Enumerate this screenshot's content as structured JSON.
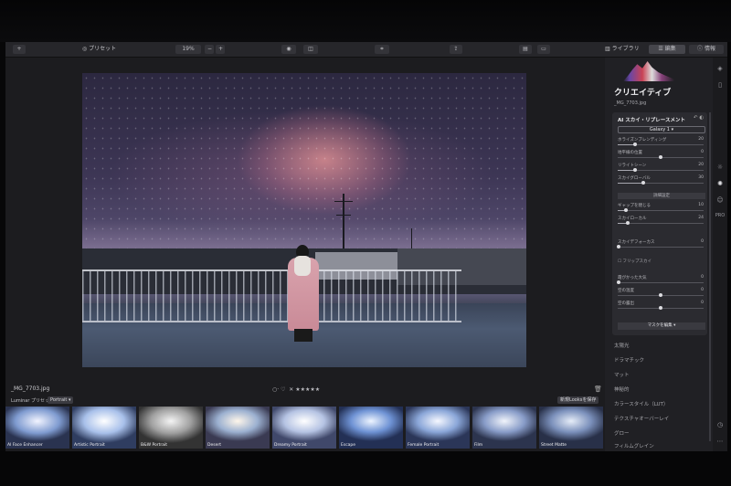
{
  "toolbar": {
    "add": "+",
    "presets": "プリセット",
    "zoom": "19%",
    "zoom_out": "−",
    "zoom_in": "+",
    "library": "ライブラリ",
    "edit": "編集",
    "info": "情報"
  },
  "image": {
    "filename": "_MG_7703.jpg"
  },
  "rating": {
    "flag_icon": "○",
    "heart": "♡",
    "reject": "✕",
    "stars": "★★★★★"
  },
  "presets_bar": {
    "label": "Luminar プリセット",
    "category": "Portrait ▾",
    "save_looks": "新規Looksを保存",
    "thumbnails": [
      "AI Face Enhancer",
      "Artistic Portrait",
      "B&W Portrait",
      "Desert",
      "Dreamy Portrait",
      "Escape",
      "Female Portrait",
      "Film",
      "Street Matte"
    ]
  },
  "panel": {
    "title": "クリエイティブ",
    "filename": "_MG_7703.jpg",
    "tool": {
      "title": "AI スカイ・リプレースメント",
      "icons": "↶ ◐",
      "sky_select": "Galaxy 1 ▾",
      "sliders": [
        {
          "label": "ホライズンブレンディング",
          "value": "20",
          "pct": 20
        },
        {
          "label": "地平線の位置",
          "value": "0",
          "pct": 50
        },
        {
          "label": "リライトシーン",
          "value": "20",
          "pct": 20
        },
        {
          "label": "スカイグローバル",
          "value": "30",
          "pct": 30
        }
      ],
      "advanced": "詳細設定",
      "sliders2": [
        {
          "label": "ギャップを閉じる",
          "value": "10",
          "pct": 10
        },
        {
          "label": "スカイローカル",
          "value": "24",
          "pct": 12
        },
        {
          "label": "スカイデフォーカス",
          "value": "0",
          "pct": 0
        }
      ],
      "flip_sky": "フリップスカイ",
      "sliders3": [
        {
          "label": "霞がかった大気",
          "value": "0",
          "pct": 0
        },
        {
          "label": "空の温度",
          "value": "0",
          "pct": 50
        },
        {
          "label": "空の露出",
          "value": "0",
          "pct": 50
        }
      ],
      "edit_mask": "マスクを編集 ▾"
    },
    "sections": [
      "太陽光",
      "ドラマチック",
      "マット",
      "神秘的",
      "カラースタイル（LUT）",
      "テクスチャオーバーレイ",
      "グロー",
      "フィルムグレイン"
    ]
  },
  "side_icons": [
    "layers-icon",
    "sliders-icon",
    "sun-icon",
    "palette-icon",
    "face-icon",
    "pro-icon",
    "clock-icon",
    "more-icon"
  ]
}
